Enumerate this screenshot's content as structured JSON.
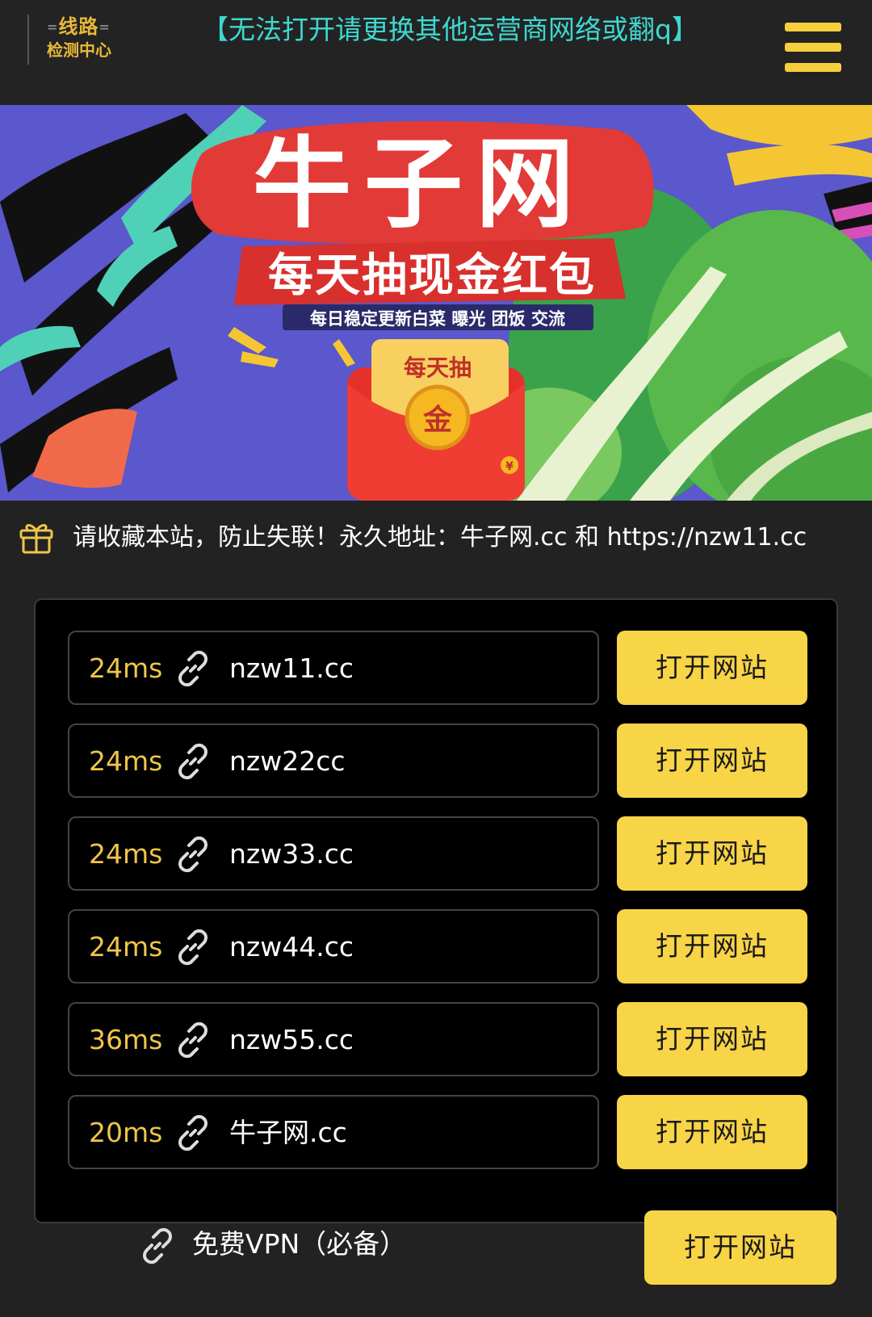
{
  "header": {
    "logo_line1": "线路",
    "logo_line2": "检测中心",
    "notice": "【无法打开请更换其他运营商网络或翻q】"
  },
  "banner": {
    "title": "牛子网",
    "subtitle": "每天抽现金红包",
    "tagline": "每日稳定更新白菜  曝光  团饭  交流",
    "envelope_top": "每天抽",
    "coin": "金",
    "yen": "¥"
  },
  "bookmark": {
    "text": "请收藏本站，防止失联！永久地址：牛子网.cc 和 https://nzw11.cc"
  },
  "lines": [
    {
      "latency": "24ms",
      "url": "nzw11.cc",
      "button": "打开网站"
    },
    {
      "latency": "24ms",
      "url": "nzw22cc",
      "button": "打开网站"
    },
    {
      "latency": "24ms",
      "url": "nzw33.cc",
      "button": "打开网站"
    },
    {
      "latency": "24ms",
      "url": "nzw44.cc",
      "button": "打开网站"
    },
    {
      "latency": "36ms",
      "url": "nzw55.cc",
      "button": "打开网站"
    },
    {
      "latency": "20ms",
      "url": "牛子网.cc",
      "button": "打开网站"
    }
  ],
  "vpn": {
    "label": "免费VPN（必备）",
    "button": "打开网站"
  },
  "colors": {
    "accent_yellow": "#f8d447",
    "notice_cyan": "#3fd8d0",
    "latency_gold": "#f0c54a",
    "background": "#222222"
  }
}
